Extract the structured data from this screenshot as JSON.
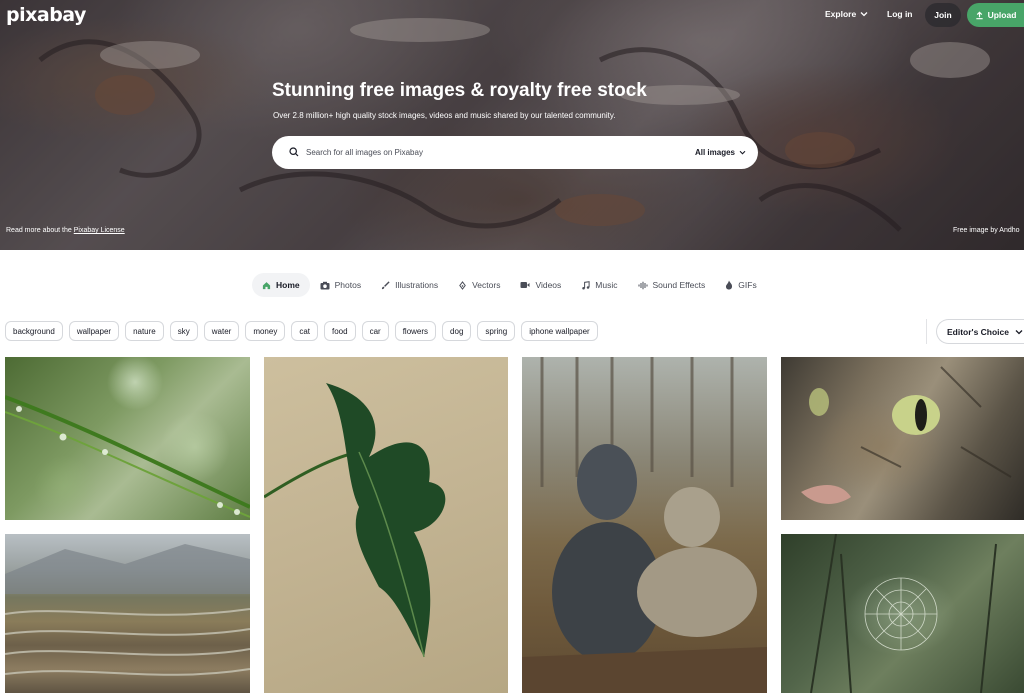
{
  "brand": {
    "logo": "pixabay"
  },
  "header": {
    "explore_label": "Explore",
    "login_label": "Log in",
    "join_label": "Join",
    "upload_label": "Upload",
    "accent_color": "#48a568"
  },
  "hero": {
    "title": "Stunning free images & royalty free stock",
    "subtitle": "Over 2.8 million+ high quality stock images, videos and music shared by our talented community.",
    "search_placeholder": "Search for all images on Pixabay",
    "search_value": "",
    "search_filter": "All images",
    "license_prefix": "Read more about the",
    "license_link": "Pixabay License",
    "credit": "Free image by Andho"
  },
  "categories": [
    {
      "label": "Home",
      "icon": "home-icon",
      "active": true
    },
    {
      "label": "Photos",
      "icon": "camera-icon",
      "active": false
    },
    {
      "label": "Illustrations",
      "icon": "brush-icon",
      "active": false
    },
    {
      "label": "Vectors",
      "icon": "pen-nib-icon",
      "active": false
    },
    {
      "label": "Videos",
      "icon": "video-icon",
      "active": false
    },
    {
      "label": "Music",
      "icon": "music-note-icon",
      "active": false
    },
    {
      "label": "Sound Effects",
      "icon": "sound-wave-icon",
      "active": false
    },
    {
      "label": "GIFs",
      "icon": "flame-icon",
      "active": false
    }
  ],
  "tags": [
    "background",
    "wallpaper",
    "nature",
    "sky",
    "water",
    "money",
    "cat",
    "food",
    "car",
    "flowers",
    "dog",
    "spring",
    "iphone wallpaper"
  ],
  "sort": {
    "label": "Editor's Choice"
  },
  "gallery": [
    {
      "subject": "grass blade with water droplets"
    },
    {
      "subject": "green philodendron leaf"
    },
    {
      "subject": "two weimaraner dogs in forest"
    },
    {
      "subject": "tabby cat eye close-up"
    },
    {
      "subject": "terraced fields in valley"
    },
    {
      "subject": "spider web on plant stems"
    }
  ]
}
